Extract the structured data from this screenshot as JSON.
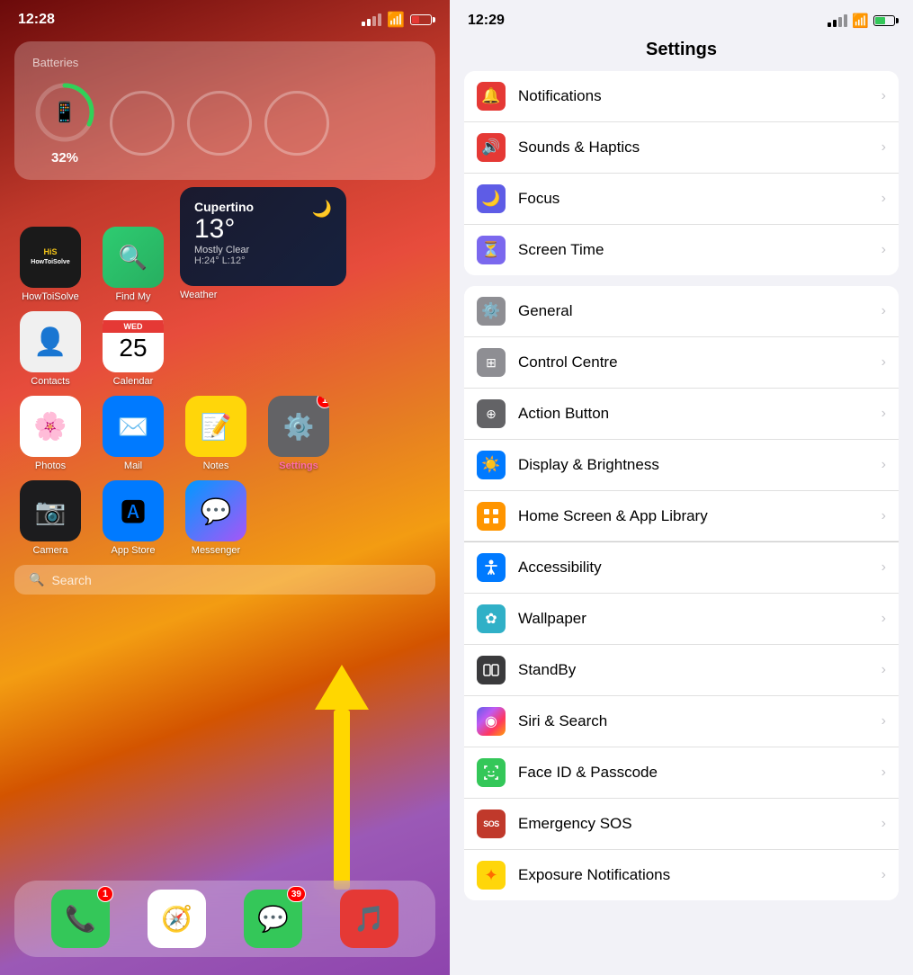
{
  "left": {
    "time": "12:28",
    "battery_pct": "32%",
    "widget_title": "Batteries",
    "search_placeholder": "Search",
    "apps_row1": [
      {
        "name": "HowToiSolve",
        "label": "HowToiSolve"
      },
      {
        "name": "Find My",
        "label": "Find My"
      },
      {
        "name": "Weather",
        "label": "Weather"
      }
    ],
    "apps_row2": [
      {
        "name": "Contacts",
        "label": "Contacts"
      },
      {
        "name": "Calendar",
        "label": "Calendar"
      },
      {
        "name": "Weather",
        "label": ""
      }
    ],
    "apps_row3": [
      {
        "name": "Photos",
        "label": "Photos"
      },
      {
        "name": "Mail",
        "label": "Mail"
      },
      {
        "name": "Notes",
        "label": "Notes"
      },
      {
        "name": "Settings",
        "label": "Settings",
        "badge": "1"
      }
    ],
    "apps_row4": [
      {
        "name": "Camera",
        "label": "Camera"
      },
      {
        "name": "App Store",
        "label": "App Store"
      },
      {
        "name": "Messenger",
        "label": "Messenger"
      }
    ],
    "weather": {
      "city": "Cupertino",
      "temp": "13°",
      "desc": "Mostly Clear",
      "range": "H:24° L:12°"
    },
    "calendar": {
      "day": "WED",
      "date": "25"
    },
    "dock": [
      {
        "name": "Phone",
        "badge": "1"
      },
      {
        "name": "Safari",
        "badge": ""
      },
      {
        "name": "Messages",
        "badge": "39"
      },
      {
        "name": "Music",
        "badge": ""
      }
    ]
  },
  "right": {
    "time": "12:29",
    "title": "Settings",
    "groups": [
      {
        "items": [
          {
            "icon": "bell",
            "icon_color": "ic-red",
            "label": "Notifications",
            "symbol": "🔔"
          },
          {
            "icon": "speaker",
            "icon_color": "ic-red",
            "label": "Sounds & Haptics",
            "symbol": "🔊"
          },
          {
            "icon": "moon",
            "icon_color": "ic-purple",
            "label": "Focus",
            "symbol": "🌙"
          },
          {
            "icon": "hourglass",
            "icon_color": "ic-purple2",
            "label": "Screen Time",
            "symbol": "⏳"
          }
        ]
      },
      {
        "items": [
          {
            "icon": "gear",
            "icon_color": "ic-gray",
            "label": "General",
            "symbol": "⚙️"
          },
          {
            "icon": "sliders",
            "icon_color": "ic-gray",
            "label": "Control Centre",
            "symbol": "🎛"
          },
          {
            "icon": "action",
            "icon_color": "ic-darkgray",
            "label": "Action Button",
            "symbol": "⊕"
          },
          {
            "icon": "sun",
            "icon_color": "ic-blue",
            "label": "Display & Brightness",
            "symbol": "☀️"
          },
          {
            "icon": "grid",
            "icon_color": "ic-orange",
            "label": "Home Screen & App Library",
            "symbol": "⊞"
          },
          {
            "icon": "accessibility",
            "icon_color": "ic-blue2",
            "label": "Accessibility",
            "symbol": "♿"
          },
          {
            "icon": "flower",
            "icon_color": "ic-teal",
            "label": "Wallpaper",
            "symbol": "✿"
          },
          {
            "icon": "standby",
            "icon_color": "ic-darkbrown",
            "label": "StandBy",
            "symbol": "⊡"
          },
          {
            "icon": "siri",
            "icon_color": "ic-gradient-siri",
            "label": "Siri & Search",
            "symbol": "◉"
          },
          {
            "icon": "faceid",
            "icon_color": "ic-green",
            "label": "Face ID & Passcode",
            "symbol": "😊"
          },
          {
            "icon": "sos",
            "icon_color": "ic-red2",
            "label": "Emergency SOS",
            "symbol": "SOS"
          },
          {
            "icon": "sun2",
            "icon_color": "ic-yellow",
            "label": "Exposure Notifications",
            "symbol": "✦"
          }
        ]
      }
    ]
  }
}
